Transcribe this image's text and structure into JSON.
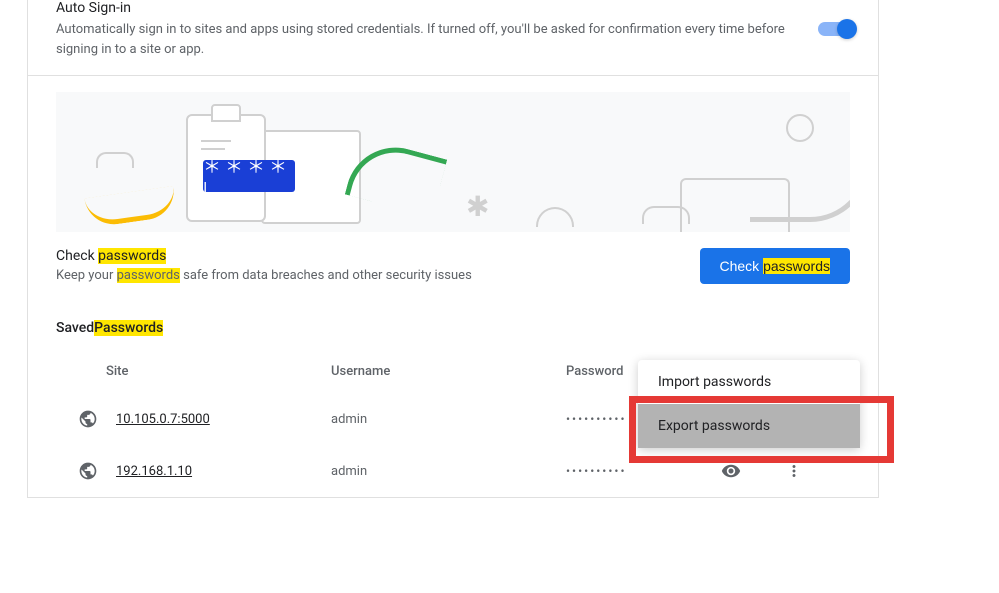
{
  "autoSignin": {
    "title": "Auto Sign-in",
    "desc": "Automatically sign in to sites and apps using stored credentials. If turned off, you'll be asked for confirmation every time before signing in to a site or app."
  },
  "illustration": {
    "stars": "＊＊＊＊ |",
    "asterisk": "✱"
  },
  "check": {
    "title_pre": "Check ",
    "title_hl": "passwords",
    "desc_pre": "Keep your ",
    "desc_hl": "passwords",
    "desc_post": " safe from data breaches and other security issues",
    "btn_pre": "Check ",
    "btn_hl": "passwords"
  },
  "savedHeader": {
    "pre": "Saved ",
    "hl": "Passwords"
  },
  "columns": {
    "site": "Site",
    "user": "Username",
    "pass": "Password"
  },
  "rows": [
    {
      "site": "10.105.0.7:5000",
      "user": "admin",
      "pass": "••••••••••"
    },
    {
      "site": "192.168.1.10",
      "user": "admin",
      "pass": "••••••••••"
    }
  ],
  "menu": {
    "import": "Import passwords",
    "export": "Export passwords"
  }
}
